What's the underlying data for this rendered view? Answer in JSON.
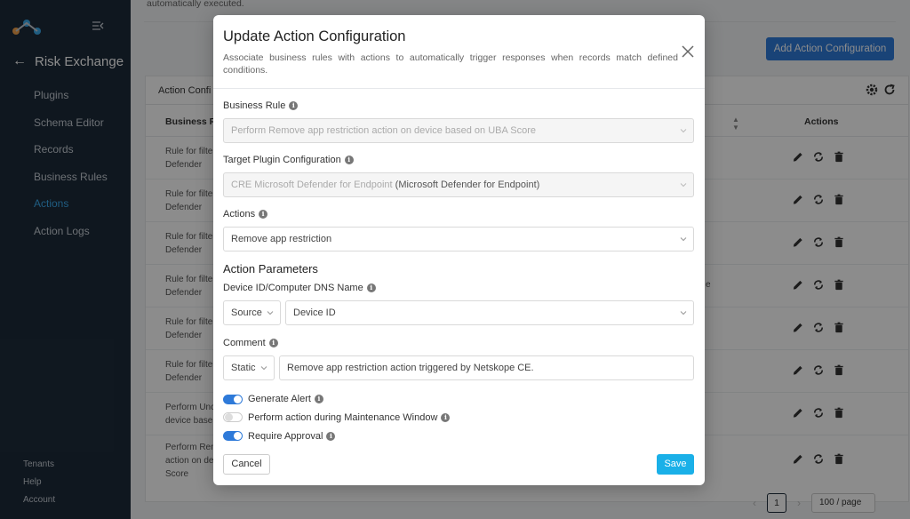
{
  "sidebar": {
    "back_label": "Risk Exchange",
    "items": [
      {
        "label": "Plugins"
      },
      {
        "label": "Schema Editor"
      },
      {
        "label": "Records"
      },
      {
        "label": "Business Rules"
      },
      {
        "label": "Actions"
      },
      {
        "label": "Action Logs"
      }
    ],
    "active_index": 4,
    "bottom": [
      "Tenants",
      "Help",
      "Account"
    ]
  },
  "background": {
    "top_text": "automatically executed.",
    "add_button": "Add Action Configuration",
    "card_title": "Action Confi",
    "columns": [
      "Business Ru",
      "Actions"
    ],
    "rows": [
      {
        "line1": "Rule for filte",
        "line2": "Defender",
        "line3": ""
      },
      {
        "line1": "Rule for filte",
        "line2": "Defender",
        "line3": ""
      },
      {
        "line1": "Rule for filte",
        "line2": "Defender",
        "line3": ""
      },
      {
        "line1": "Rule for filte",
        "line2": "Defender",
        "line3": ""
      },
      {
        "line1": "Rule for filte",
        "line2": "Defender",
        "line3": ""
      },
      {
        "line1": "Rule for filte",
        "line2": "Defender",
        "line3": ""
      },
      {
        "line1": "Perform Unc",
        "line2": "device base",
        "line3": ""
      },
      {
        "line1": "Perform Ren",
        "line2": "action on de",
        "line3": "Score"
      }
    ],
    "row4_extra": "e",
    "pagination": {
      "page": "1",
      "page_size": "100 / page"
    }
  },
  "modal": {
    "title": "Update Action Configuration",
    "description": "Associate business rules with actions to automatically trigger responses when records match defined conditions.",
    "business_rule": {
      "label": "Business Rule",
      "value": "Perform Remove app restriction action on device based on UBA Score"
    },
    "target_plugin": {
      "label": "Target Plugin Configuration",
      "value": "CRE Microsoft Defender for Endpoint",
      "value_suffix": "(Microsoft Defender for Endpoint)"
    },
    "actions": {
      "label": "Actions",
      "value": "Remove app restriction"
    },
    "section_title": "Action Parameters",
    "device_id": {
      "label": "Device ID/Computer DNS Name",
      "type": "Source",
      "value": "Device ID"
    },
    "comment": {
      "label": "Comment",
      "type": "Static",
      "value": "Remove app restriction action triggered by Netskope CE."
    },
    "toggles": [
      {
        "label": "Generate Alert",
        "on": true
      },
      {
        "label": "Perform action during Maintenance Window",
        "on": false
      },
      {
        "label": "Require Approval",
        "on": true
      }
    ],
    "cancel_label": "Cancel",
    "save_label": "Save"
  },
  "colors": {
    "sidebar_bg": "#1d2b3a",
    "active": "#3aa9ec",
    "primary_button": "#2e7ad9",
    "save_button": "#1ab0e8",
    "toggle_on": "#2e7ad9"
  }
}
